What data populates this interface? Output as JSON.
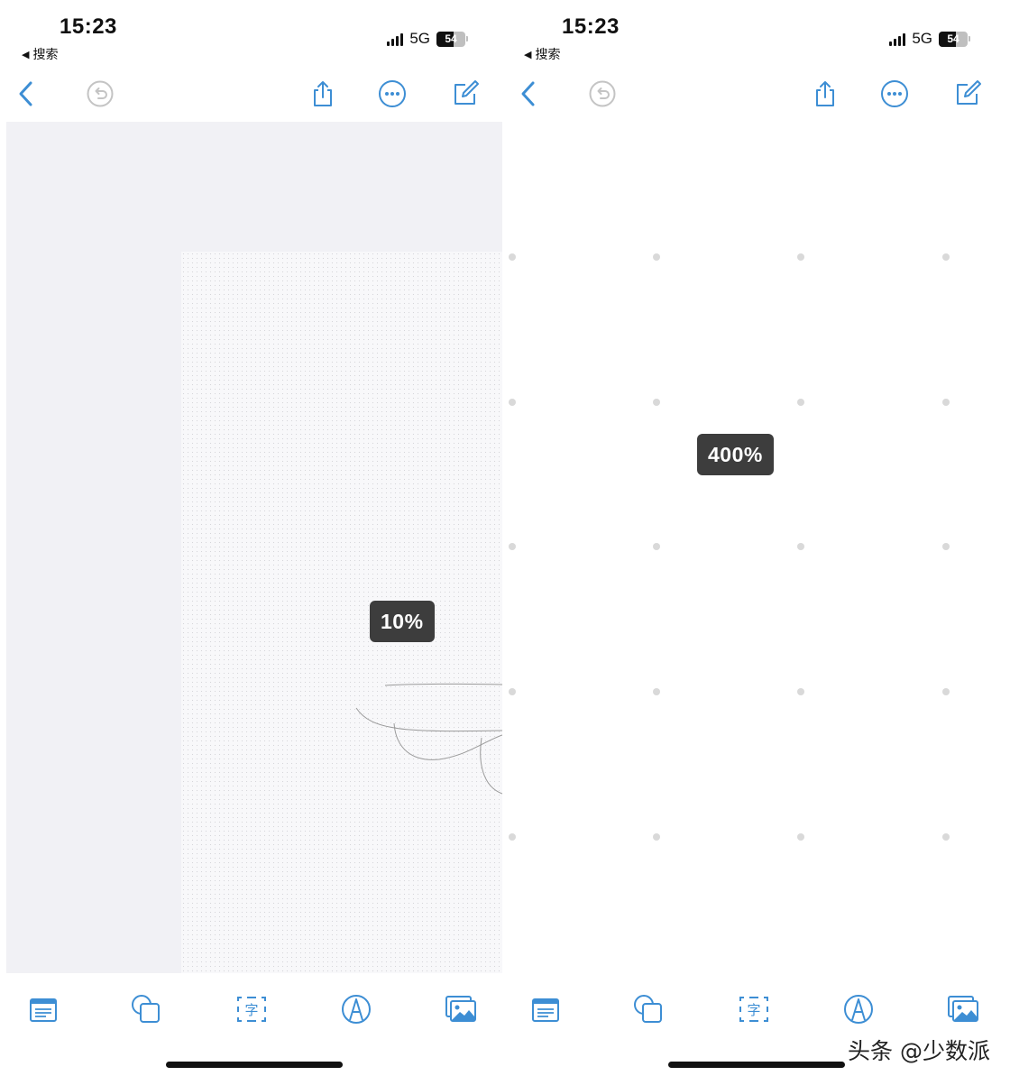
{
  "screens": [
    {
      "status": {
        "time": "15:23",
        "back_label": "搜索",
        "network": "5G",
        "battery": "54"
      },
      "zoom_label": "10%"
    },
    {
      "status": {
        "time": "15:23",
        "back_label": "搜索",
        "network": "5G",
        "battery": "54"
      },
      "zoom_label": "400%"
    }
  ],
  "toolbar_icons": [
    "chevron-left-icon",
    "undo-icon",
    "share-icon",
    "more-icon",
    "compose-icon"
  ],
  "bottom_icons": [
    "notes-icon",
    "shapes-icon",
    "text-icon",
    "pen-icon",
    "image-icon"
  ],
  "accent_color": "#3d8ed4",
  "disabled_color": "#c4c4c4",
  "watermark": "头条 @少数派"
}
